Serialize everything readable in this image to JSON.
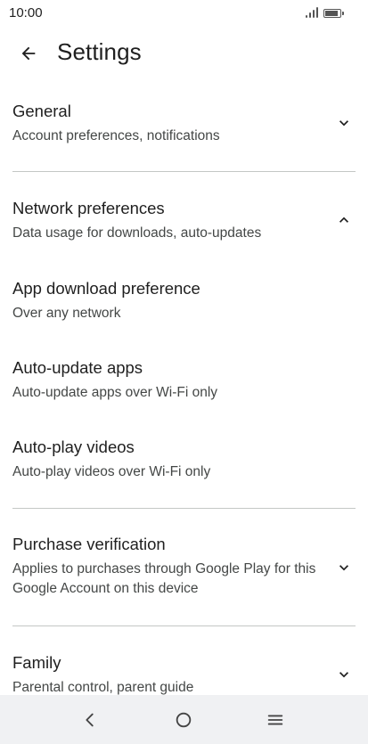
{
  "status_bar": {
    "time": "10:00"
  },
  "app_bar": {
    "title": "Settings",
    "back_icon": "arrow-left-icon"
  },
  "settings": [
    {
      "id": "general",
      "title": "General",
      "subtitle": "Account preferences, notifications",
      "chevron": "chevron-down-icon",
      "expanded": false
    },
    {
      "id": "network-preferences",
      "title": "Network preferences",
      "subtitle": "Data usage for downloads, auto-updates",
      "chevron": "chevron-up-icon",
      "expanded": true
    },
    {
      "id": "app-download-preference",
      "title": "App download preference",
      "subtitle": "Over any network"
    },
    {
      "id": "auto-update-apps",
      "title": "Auto-update apps",
      "subtitle": "Auto-update apps over Wi-Fi only"
    },
    {
      "id": "auto-play-videos",
      "title": "Auto-play videos",
      "subtitle": "Auto-play videos over Wi-Fi only"
    },
    {
      "id": "purchase-verification",
      "title": "Purchase verification",
      "subtitle": "Applies to purchases through Google Play for this Google Account on this device",
      "chevron": "chevron-down-icon",
      "expanded": false
    },
    {
      "id": "family",
      "title": "Family",
      "subtitle": "Parental control, parent guide",
      "chevron": "chevron-down-icon",
      "expanded": false
    }
  ],
  "nav_bar": {
    "back_icon": "nav-back-icon",
    "home_icon": "nav-home-icon",
    "menu_icon": "nav-menu-icon"
  },
  "colors": {
    "text_primary": "#1f1f1f",
    "text_secondary": "#444746",
    "divider": "#c4c7c5",
    "nav_bar_bg": "#f0f1f3"
  }
}
